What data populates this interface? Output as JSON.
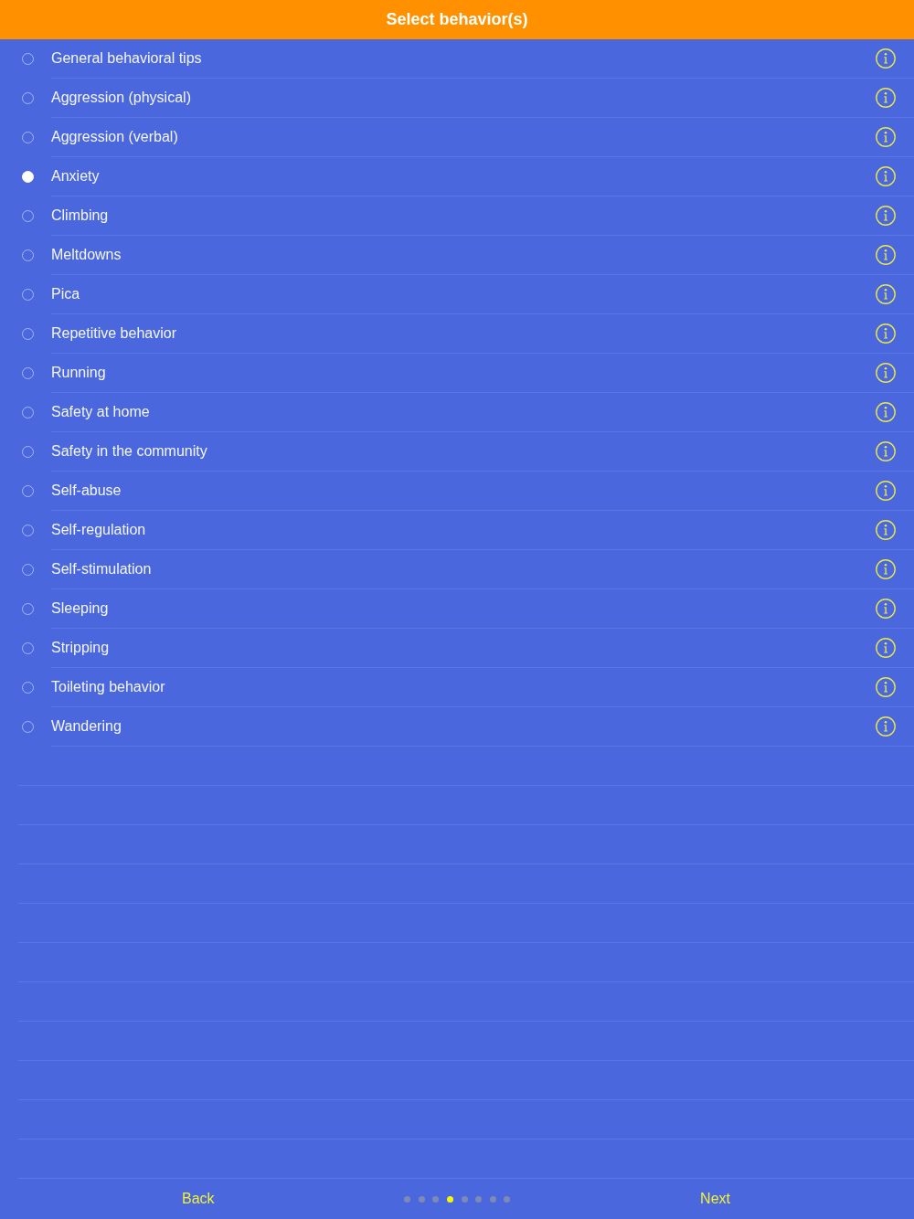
{
  "header": {
    "title": "Select behavior(s)"
  },
  "behaviors": [
    {
      "label": "General behavioral tips",
      "selected": false
    },
    {
      "label": "Aggression (physical)",
      "selected": false
    },
    {
      "label": "Aggression (verbal)",
      "selected": false
    },
    {
      "label": "Anxiety",
      "selected": true
    },
    {
      "label": "Climbing",
      "selected": false
    },
    {
      "label": "Meltdowns",
      "selected": false
    },
    {
      "label": "Pica",
      "selected": false
    },
    {
      "label": "Repetitive behavior",
      "selected": false
    },
    {
      "label": "Running",
      "selected": false
    },
    {
      "label": "Safety at home",
      "selected": false
    },
    {
      "label": "Safety in the community",
      "selected": false
    },
    {
      "label": "Self-abuse",
      "selected": false
    },
    {
      "label": "Self-regulation",
      "selected": false
    },
    {
      "label": "Self-stimulation",
      "selected": false
    },
    {
      "label": "Sleeping",
      "selected": false
    },
    {
      "label": "Stripping",
      "selected": false
    },
    {
      "label": "Toileting behavior",
      "selected": false
    },
    {
      "label": "Wandering",
      "selected": false
    }
  ],
  "footer": {
    "back": "Back",
    "next": "Next",
    "pages": [
      {
        "selected": false
      },
      {
        "selected": false
      },
      {
        "selected": false
      },
      {
        "selected": true
      },
      {
        "selected": false
      },
      {
        "selected": false
      },
      {
        "selected": false
      },
      {
        "selected": false
      }
    ]
  }
}
